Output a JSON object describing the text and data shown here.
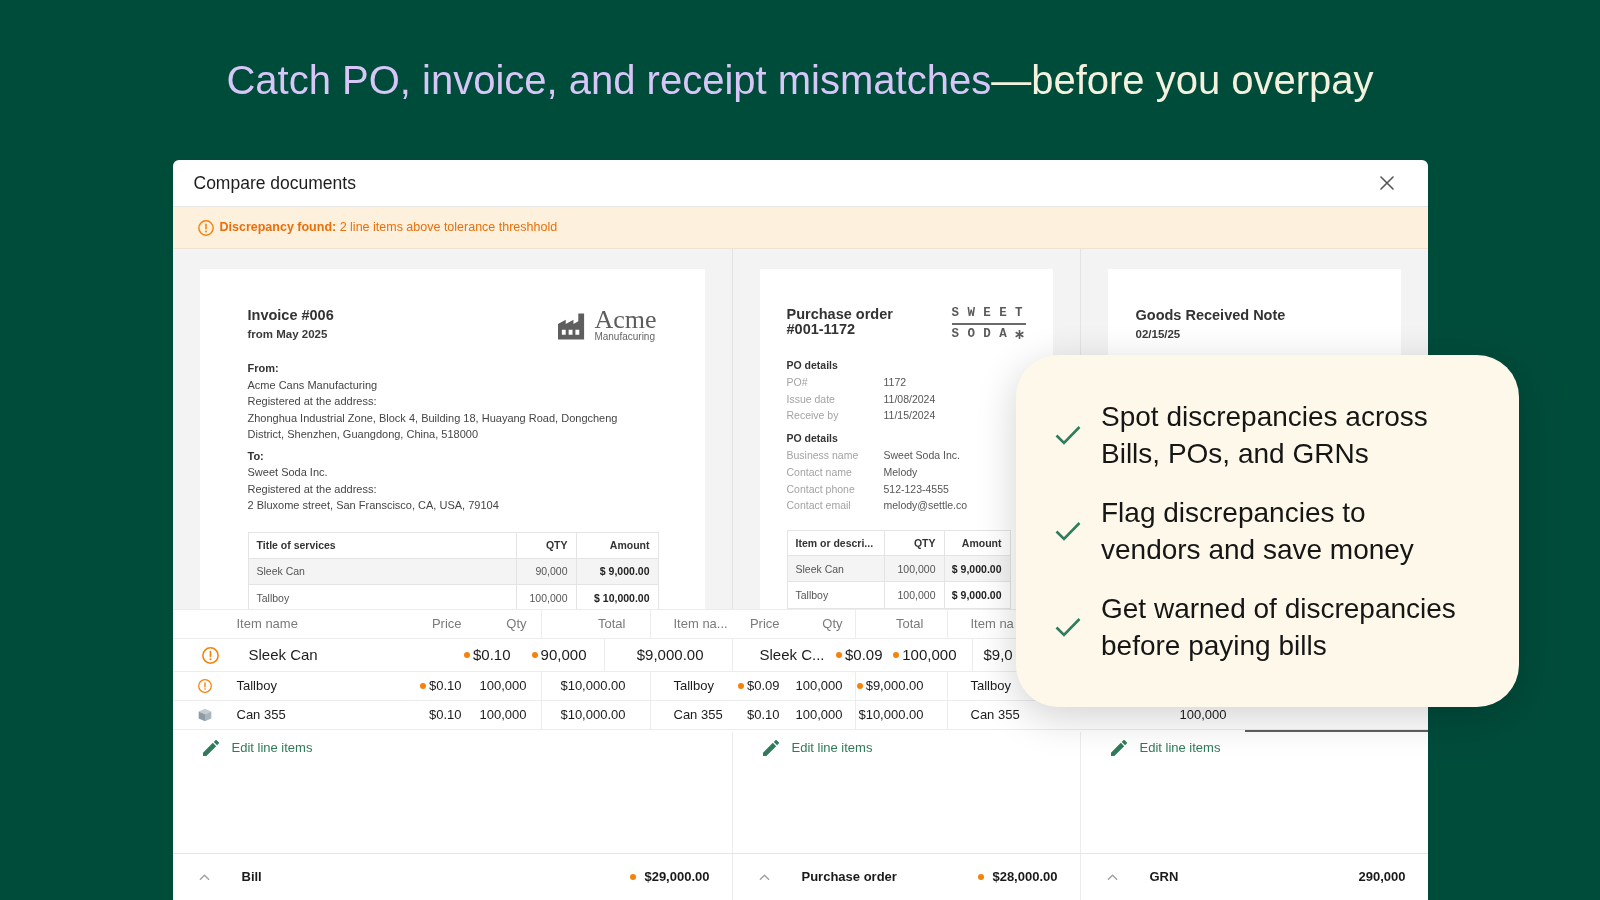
{
  "headline": {
    "lead": "Catch PO, invoice, and receipt mismatches",
    "rest": "—before you overpay"
  },
  "dialog": {
    "title": "Compare documents"
  },
  "alert": {
    "message": "**Discrepancy found:** 2 line items above tolerance threshhold"
  },
  "documents": [
    {
      "kind": "invoice",
      "title": "Invoice #006",
      "subtitle": "from May 2025",
      "logo": {
        "name": "Acme",
        "tagline": "Manufacuring"
      },
      "parties": [
        {
          "heading": "From:",
          "lines": [
            "Acme Cans Manufacturing",
            "Registered at the address:",
            "Zhonghua Industrial Zone, Block 4, Building 18, Huayang Road, Dongcheng District, Shenzhen, Guangdong, China, 518000"
          ]
        },
        {
          "heading": "To:",
          "lines": [
            "Sweet Soda Inc.",
            "Registered at the address:",
            "2 Bluxome street, San Franscisco, CA, USA, 79104"
          ]
        }
      ],
      "table": {
        "columns": [
          "Title of services",
          "QTY",
          "Amount"
        ],
        "rows": [
          [
            "Sleek Can",
            "90,000",
            "$ 9,000.00"
          ],
          [
            "Tallboy",
            "100,000",
            "$ 10,000.00"
          ]
        ]
      },
      "edit_label": "Edit line items"
    },
    {
      "kind": "purchase_order",
      "title": "Purchase order #001-1172",
      "logo": {
        "top": "SWEET",
        "bottom": "SODA"
      },
      "sections": [
        {
          "heading": "PO details",
          "fields": [
            {
              "label": "PO#",
              "value": "1172"
            },
            {
              "label": "Issue date",
              "value": "11/08/2024"
            },
            {
              "label": "Receive by",
              "value": "11/15/2024"
            }
          ]
        },
        {
          "heading": "PO details",
          "fields": [
            {
              "label": "Business name",
              "value": "Sweet Soda Inc."
            },
            {
              "label": "Contact name",
              "value": "Melody"
            },
            {
              "label": "Contact phone",
              "value": "512-123-4555"
            },
            {
              "label": "Contact email",
              "value": "melody@settle.co"
            }
          ]
        }
      ],
      "table": {
        "columns": [
          "Item or descri...",
          "QTY",
          "Amount"
        ],
        "rows": [
          [
            "Sleek Can",
            "100,000",
            "$ 9,000.00"
          ],
          [
            "Tallboy",
            "100,000",
            "$ 9,000.00"
          ]
        ]
      },
      "edit_label": "Edit line items"
    },
    {
      "kind": "grn",
      "title": "Goods Received Note",
      "subtitle": "02/15/25",
      "edit_label": "Edit line items"
    }
  ],
  "line_items": {
    "columns": [
      "Item name",
      "Price",
      "Qty",
      "Total",
      "Item na...",
      "Price",
      "Qty",
      "Total",
      "Item na"
    ],
    "focused_row": {
      "flagged": true,
      "cells": [
        {
          "text": "Sleek Can",
          "flagged": false
        },
        {
          "text": "$0.10",
          "flagged": true
        },
        {
          "text": "90,000",
          "flagged": true
        },
        {
          "text": "$9,000.00",
          "flagged": false
        },
        {
          "text": "Sleek C...",
          "flagged": false
        },
        {
          "text": "$0.09",
          "flagged": true
        },
        {
          "text": "100,000",
          "flagged": true
        },
        {
          "text": "$9,0",
          "flagged": false
        }
      ]
    },
    "rows": [
      {
        "flagged": true,
        "cells": [
          {
            "text": "Tallboy",
            "flagged": false
          },
          {
            "text": "$0.10",
            "flagged": true
          },
          {
            "text": "100,000",
            "flagged": false
          },
          {
            "text": "$10,000.00",
            "flagged": false
          },
          {
            "text": "Tallboy",
            "flagged": false
          },
          {
            "text": "$0.09",
            "flagged": true
          },
          {
            "text": "100,000",
            "flagged": false
          },
          {
            "text": "$9,000.00",
            "flagged": true
          },
          {
            "text": "Tallboy",
            "flagged": false
          }
        ]
      },
      {
        "flagged": false,
        "cells": [
          {
            "text": "Can 355",
            "flagged": false
          },
          {
            "text": "$0.10",
            "flagged": false
          },
          {
            "text": "100,000",
            "flagged": false
          },
          {
            "text": "$10,000.00",
            "flagged": false
          },
          {
            "text": "Can 355",
            "flagged": false
          },
          {
            "text": "$0.10",
            "flagged": false
          },
          {
            "text": "100,000",
            "flagged": false
          },
          {
            "text": "$10,000.00",
            "flagged": false
          },
          {
            "text": "Can 355",
            "flagged": false
          },
          {
            "text": "100,000",
            "flagged": false
          }
        ]
      }
    ]
  },
  "summary": [
    {
      "label": "Bill",
      "total": "$29,000.00",
      "flagged": true
    },
    {
      "label": "Purchase order",
      "total": "$28,000.00",
      "flagged": true
    },
    {
      "label": "GRN",
      "total": "290,000",
      "flagged": false
    }
  ],
  "highlights": [
    "Spot discrepancies across Bills, POs, and GRNs",
    "Flag discrepancies to vendors and save money",
    "Get warned of discrepancies before paying bills"
  ]
}
